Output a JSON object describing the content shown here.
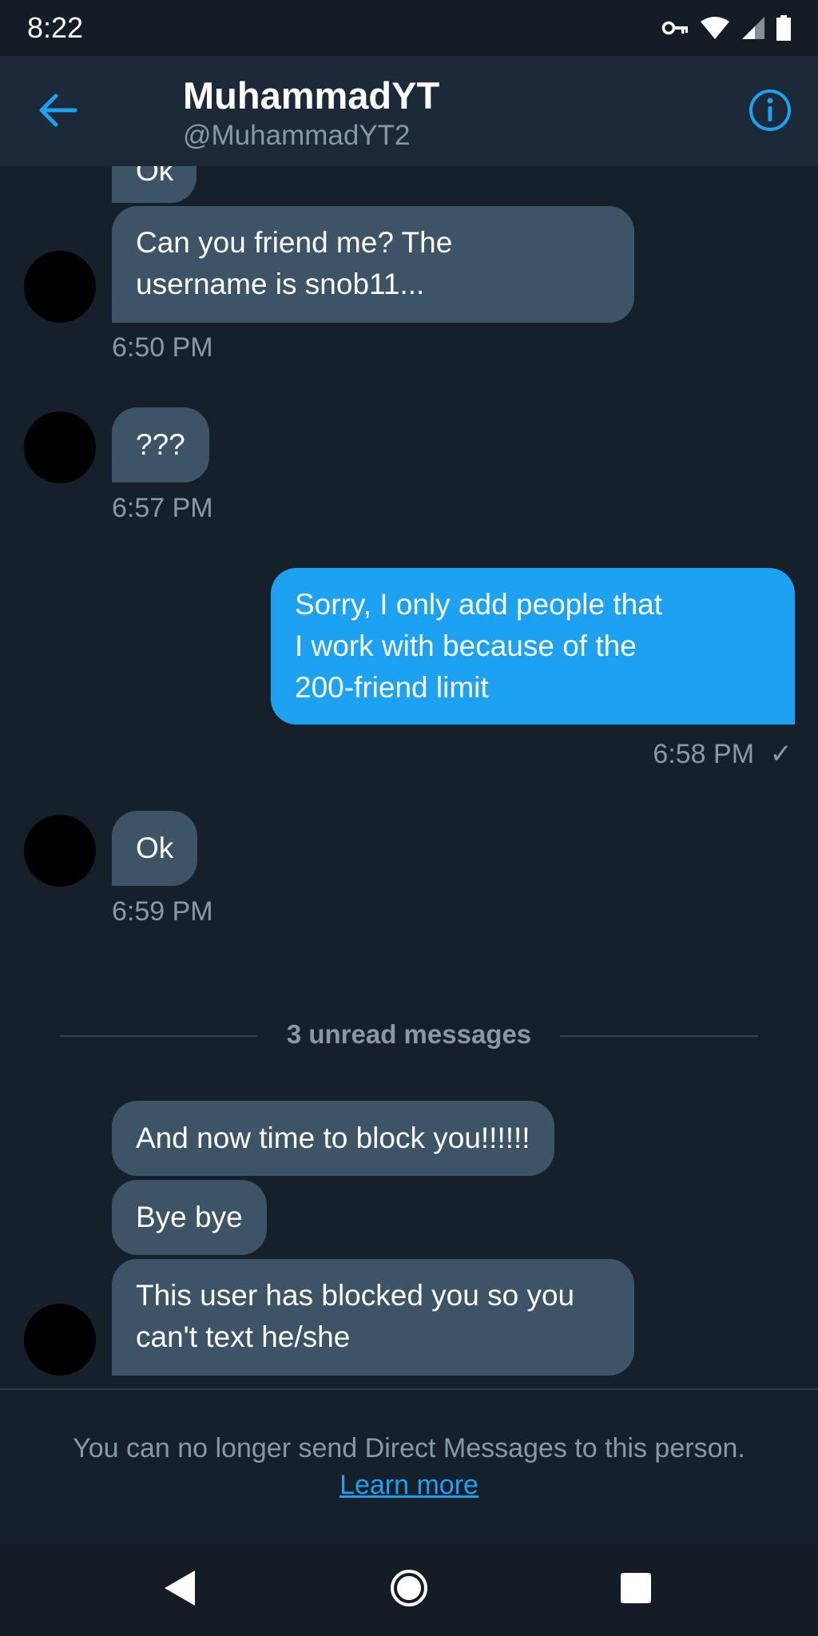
{
  "status_bar": {
    "time": "8:22"
  },
  "header": {
    "name": "MuhammadYT",
    "handle": "@MuhammadYT2"
  },
  "messages": {
    "m0_text": "Ok",
    "m1_line1": "Can you friend me? The",
    "m1_line2": "username is snob11...",
    "m1_time": "6:50 PM",
    "m2_text": "???",
    "m2_time": "6:57 PM",
    "m3_line1": "Sorry, I only add people that",
    "m3_line2": "I work with because of the",
    "m3_line3": "200-friend limit",
    "m3_time": "6:58 PM",
    "m3_status": "✓",
    "m4_text": "Ok",
    "m4_time": "6:59 PM",
    "unread_label": "3 unread messages",
    "m5_text": "And now time to block you!!!!!!",
    "m6_text": "Bye bye",
    "m7_line1": "This user has blocked you so you",
    "m7_line2": "can't text he/she"
  },
  "footer": {
    "notice": "You can no longer send Direct Messages to this person.",
    "learn_more": "Learn more"
  },
  "colors": {
    "background": "#15202b",
    "header": "#1c2938",
    "incoming_bubble": "#3d5466",
    "outgoing_bubble": "#1da1f2",
    "accent": "#1da1f2",
    "secondary_text": "#8899a6"
  },
  "icons": {
    "back": "arrow-left-icon",
    "info": "info-icon",
    "vpn": "key-icon",
    "wifi": "wifi-icon",
    "signal": "signal-icon",
    "battery": "battery-icon",
    "nav_back": "triangle-back-icon",
    "nav_home": "circle-home-icon",
    "nav_recents": "square-recents-icon"
  }
}
